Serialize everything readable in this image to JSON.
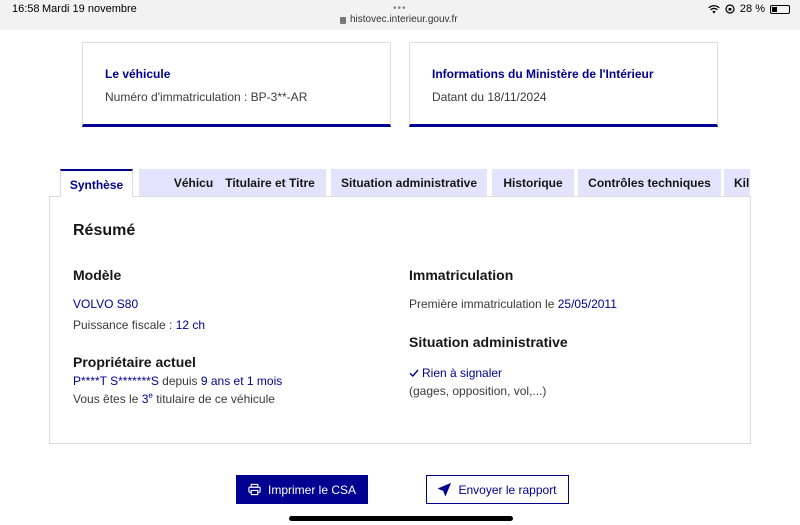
{
  "status_bar": {
    "time": "16:58",
    "date": "Mardi 19 novembre",
    "dots": "•••",
    "url": "histovec.interieur.gouv.fr",
    "battery": "28 %"
  },
  "cards": [
    {
      "title": "Le véhicule",
      "text": "Numéro d'immatriculation : BP-3**-AR"
    },
    {
      "title": "Informations du Ministère de l'Intérieur",
      "text": "Datant du 18/11/2024"
    }
  ],
  "tabs": [
    {
      "label": "Synthèse",
      "active": true
    },
    {
      "label": "Véhicule"
    },
    {
      "label": "Titulaire et Titre"
    },
    {
      "label": "Situation administrative"
    },
    {
      "label": "Historique"
    },
    {
      "label": "Contrôles techniques"
    },
    {
      "label": "Kil"
    }
  ],
  "summary": {
    "title": "Résumé",
    "modele": {
      "heading": "Modèle",
      "name": "VOLVO S80",
      "puissance_label": "Puissance fiscale : ",
      "puissance_value": "12 ch"
    },
    "proprietaire": {
      "heading": "Propriétaire actuel",
      "name": "P****T S*******S",
      "depuis_label": " depuis ",
      "depuis_value": "9 ans et 1 mois",
      "titulaire_pre": "Vous êtes le ",
      "titulaire_num": "3",
      "titulaire_sup": "e",
      "titulaire_post": " titulaire de ce véhicule"
    },
    "immatriculation": {
      "heading": "Immatriculation",
      "label": "Première immatriculation le ",
      "date": "25/05/2011"
    },
    "situation": {
      "heading": "Situation administrative",
      "status": "Rien à signaler",
      "detail": "(gages, opposition, vol,...)"
    }
  },
  "actions": {
    "print_label": "Imprimer le CSA",
    "send_label": "Envoyer le rapport"
  },
  "colors": {
    "primary": "#000091",
    "tab_bg": "#e3e3fd"
  }
}
